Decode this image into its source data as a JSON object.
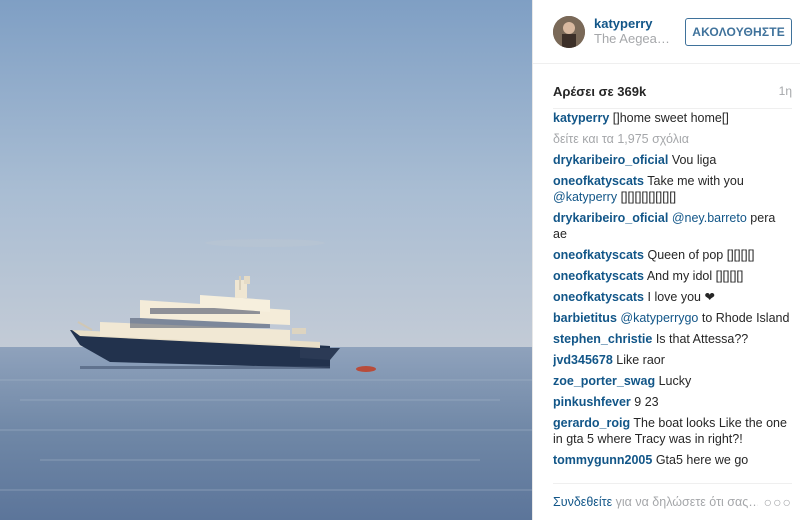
{
  "post": {
    "username": "katyperry",
    "location": "The Aegea…",
    "follow_label": "ΑΚΟΛΟΥΘΗΣΤΕ",
    "likes": "Αρέσει σε 369k",
    "time": "1η",
    "caption_user": "katyperry",
    "caption_text": "[]home sweet home[]",
    "view_all": "δείτε και τα 1,975 σχόλια"
  },
  "comments": [
    {
      "user": "drykaribeiro_oficial",
      "text": "Vou liga"
    },
    {
      "user": "oneofkatyscats",
      "text": "Take me with you",
      "mention": "@katyperry",
      "after": "[][][][][][][][]"
    },
    {
      "user": "drykaribeiro_oficial",
      "text": "",
      "mention": "@ney.barreto",
      "after": "pera ae"
    },
    {
      "user": "oneofkatyscats",
      "text": "Queen of pop [][][][]"
    },
    {
      "user": "oneofkatyscats",
      "text": "And my idol [][][][]"
    },
    {
      "user": "oneofkatyscats",
      "text": "I love you ❤"
    },
    {
      "user": "barbietitus",
      "text": "",
      "mention": "@katyperrygo",
      "after": "to Rhode Island"
    },
    {
      "user": "stephen_christie",
      "text": "Is that Attessa??"
    },
    {
      "user": "jvd345678",
      "text": "Like raor"
    },
    {
      "user": "zoe_porter_swag",
      "text": "Lucky"
    },
    {
      "user": "pinkushfever",
      "text": "9 23"
    },
    {
      "user": "gerardo_roig",
      "text": "The boat looks Like the one in gta 5 where Tracy was in right?!"
    },
    {
      "user": "tommygunn2005",
      "text": "Gta5 here we go"
    }
  ],
  "footer": {
    "login_link": "Συνδεθείτε",
    "prompt_rest": " για να δηλώσετε ότι σας…",
    "more_icon": "ellipsis-icon"
  },
  "colors": {
    "link": "#125688",
    "button": "#3f729b",
    "muted": "#a5a7aa"
  }
}
